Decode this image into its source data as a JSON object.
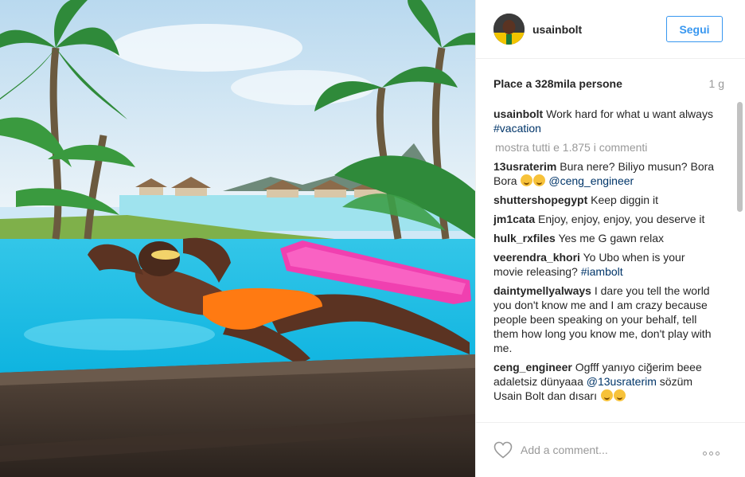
{
  "post": {
    "username": "usainbolt",
    "follow_label": "Segui",
    "likes_text": "Place a 328mila persone",
    "time_ago": "1 g",
    "load_more_label": "mostra tutti e 1.875 i commenti",
    "comment_placeholder": "Add a comment..."
  },
  "comments": [
    {
      "user": "usainbolt",
      "parts": [
        {
          "text": "Work hard for what u want always "
        },
        {
          "text": "#vacation",
          "link": true
        }
      ]
    },
    {
      "user": "13usraterim",
      "parts": [
        {
          "text": "Bura nere? Biliyo musun? Bora Bora "
        },
        {
          "emoji": true
        },
        {
          "emoji": true
        },
        {
          "text": " "
        },
        {
          "text": "@ceng_engineer",
          "link": true
        }
      ]
    },
    {
      "user": "shuttershopegypt",
      "parts": [
        {
          "text": "Keep diggin it"
        }
      ]
    },
    {
      "user": "jm1cata",
      "parts": [
        {
          "text": "Enjoy, enjoy, enjoy, you deserve it"
        }
      ]
    },
    {
      "user": "hulk_rxfiles",
      "parts": [
        {
          "text": "Yes me G gawn relax"
        }
      ]
    },
    {
      "user": "veerendra_khori",
      "parts": [
        {
          "text": "Yo Ubo when is your movie releasing? "
        },
        {
          "text": "#iambolt",
          "link": true
        }
      ]
    },
    {
      "user": "daintymellyalways",
      "parts": [
        {
          "text": "I dare you tell the world you don't know me and I am crazy because people been speaking on your behalf, tell them how long you know me, don't play with me."
        }
      ]
    },
    {
      "user": "ceng_engineer",
      "parts": [
        {
          "text": "Ogfff yanıyo ciğerim beee adaletsiz dünyaaa "
        },
        {
          "text": "@13usraterim",
          "link": true
        },
        {
          "text": " sözüm Usain Bolt dan dısarı "
        },
        {
          "emoji": true
        },
        {
          "emoji": true
        }
      ]
    }
  ],
  "colors": {
    "accent": "#3897f0",
    "link": "#003569",
    "muted": "#999999"
  },
  "icons": {
    "heart": "heart-icon",
    "more": "more-options-icon"
  }
}
